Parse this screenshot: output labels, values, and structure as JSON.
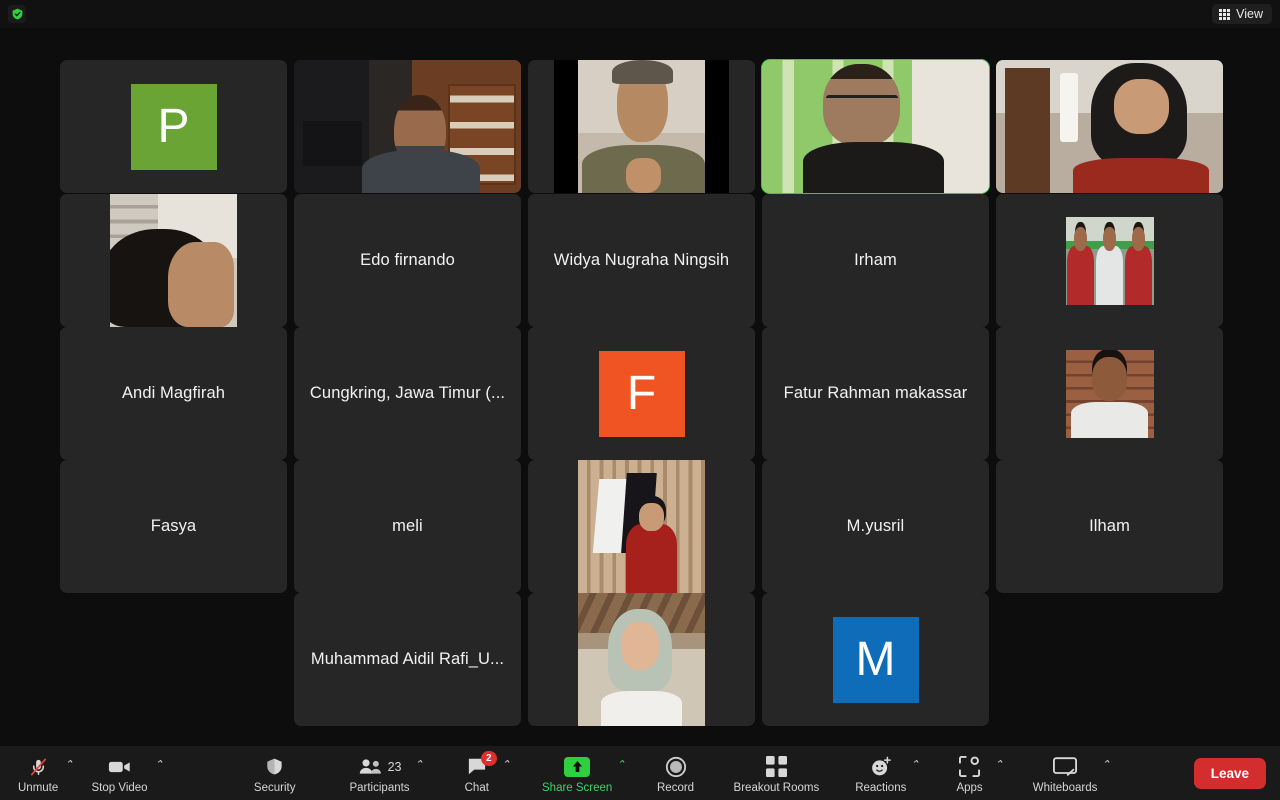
{
  "app": {
    "title": "Zoom Meeting"
  },
  "topbar": {
    "encryption_icon": "shield-check-icon",
    "encryption_color": "#2ed03f",
    "view_label": "View",
    "view_icon": "grid-icon"
  },
  "gallery": {
    "rows": [
      {
        "tiles": [
          {
            "name": "",
            "kind": "avatar",
            "avatar_letter": "P",
            "avatar_color": "#6aa434",
            "active": false
          },
          {
            "name": "",
            "kind": "video",
            "video": "v-office",
            "active": false
          },
          {
            "name": "",
            "kind": "video",
            "video": "v-plain",
            "letterbox": true,
            "active": false
          },
          {
            "name": "",
            "kind": "video",
            "video": "v-green",
            "active": true
          },
          {
            "name": "",
            "kind": "video",
            "video": "v-hijab",
            "active": false
          }
        ]
      },
      {
        "tiles": [
          {
            "name": "",
            "kind": "photo",
            "video": "v-closeup",
            "shape": "portrait",
            "active": false
          },
          {
            "name": "Edo firnando",
            "kind": "name",
            "active": false
          },
          {
            "name": "Widya Nugraha Ningsih",
            "kind": "name",
            "active": false
          },
          {
            "name": "Irham",
            "kind": "name",
            "active": false
          },
          {
            "name": "",
            "kind": "photo",
            "video": "v-group",
            "shape": "square",
            "active": false
          }
        ]
      },
      {
        "tiles": [
          {
            "name": "Andi Magfirah",
            "kind": "name",
            "active": false
          },
          {
            "name": "Cungkring, Jawa Timur (...",
            "kind": "name",
            "active": false
          },
          {
            "name": "",
            "kind": "avatar",
            "avatar_letter": "F",
            "avatar_color": "#f05423",
            "active": false
          },
          {
            "name": "Fatur Rahman makassar",
            "kind": "name",
            "active": false
          },
          {
            "name": "",
            "kind": "photo",
            "video": "v-brick",
            "shape": "square",
            "active": false
          }
        ]
      },
      {
        "tiles": [
          {
            "name": "Fasya",
            "kind": "name",
            "active": false
          },
          {
            "name": "meli",
            "kind": "name",
            "active": false
          },
          {
            "name": "",
            "kind": "photo",
            "video": "v-flags",
            "shape": "portrait",
            "active": false
          },
          {
            "name": "M.yusril",
            "kind": "name",
            "active": false
          },
          {
            "name": "Ilham",
            "kind": "name",
            "active": false
          }
        ]
      },
      {
        "offset_cols": 1,
        "tiles": [
          {
            "name": "Muhammad Aidil Rafi_U...",
            "kind": "name",
            "active": false
          },
          {
            "name": "",
            "kind": "photo",
            "video": "v-cafe",
            "shape": "portrait",
            "active": false
          },
          {
            "name": "",
            "kind": "avatar",
            "avatar_letter": "M",
            "avatar_color": "#0e6cb8",
            "active": false
          }
        ]
      }
    ],
    "active_speaker_border_color": "#2ed03f"
  },
  "toolbar": {
    "mute": {
      "label": "Unmute",
      "icon": "microphone-muted-icon",
      "has_caret": true
    },
    "video": {
      "label": "Stop Video",
      "icon": "video-camera-icon",
      "has_caret": true
    },
    "security": {
      "label": "Security",
      "icon": "shield-icon",
      "has_caret": false
    },
    "participants": {
      "label": "Participants",
      "icon": "people-icon",
      "count": "23",
      "has_caret": true
    },
    "chat": {
      "label": "Chat",
      "icon": "chat-bubble-icon",
      "badge": "2",
      "has_caret": true
    },
    "share": {
      "label": "Share Screen",
      "icon": "share-arrow-up-icon",
      "has_caret": true,
      "color": "#3ad46a"
    },
    "record": {
      "label": "Record",
      "icon": "record-circle-icon",
      "has_caret": false
    },
    "breakout": {
      "label": "Breakout Rooms",
      "icon": "grid-squares-icon",
      "has_caret": false
    },
    "reactions": {
      "label": "Reactions",
      "icon": "smiley-plus-icon",
      "has_caret": true
    },
    "apps": {
      "label": "Apps",
      "icon": "apps-icon",
      "has_caret": true
    },
    "whiteboards": {
      "label": "Whiteboards",
      "icon": "whiteboard-icon",
      "has_caret": true
    },
    "leave": {
      "label": "Leave",
      "color": "#d32d2d"
    }
  }
}
